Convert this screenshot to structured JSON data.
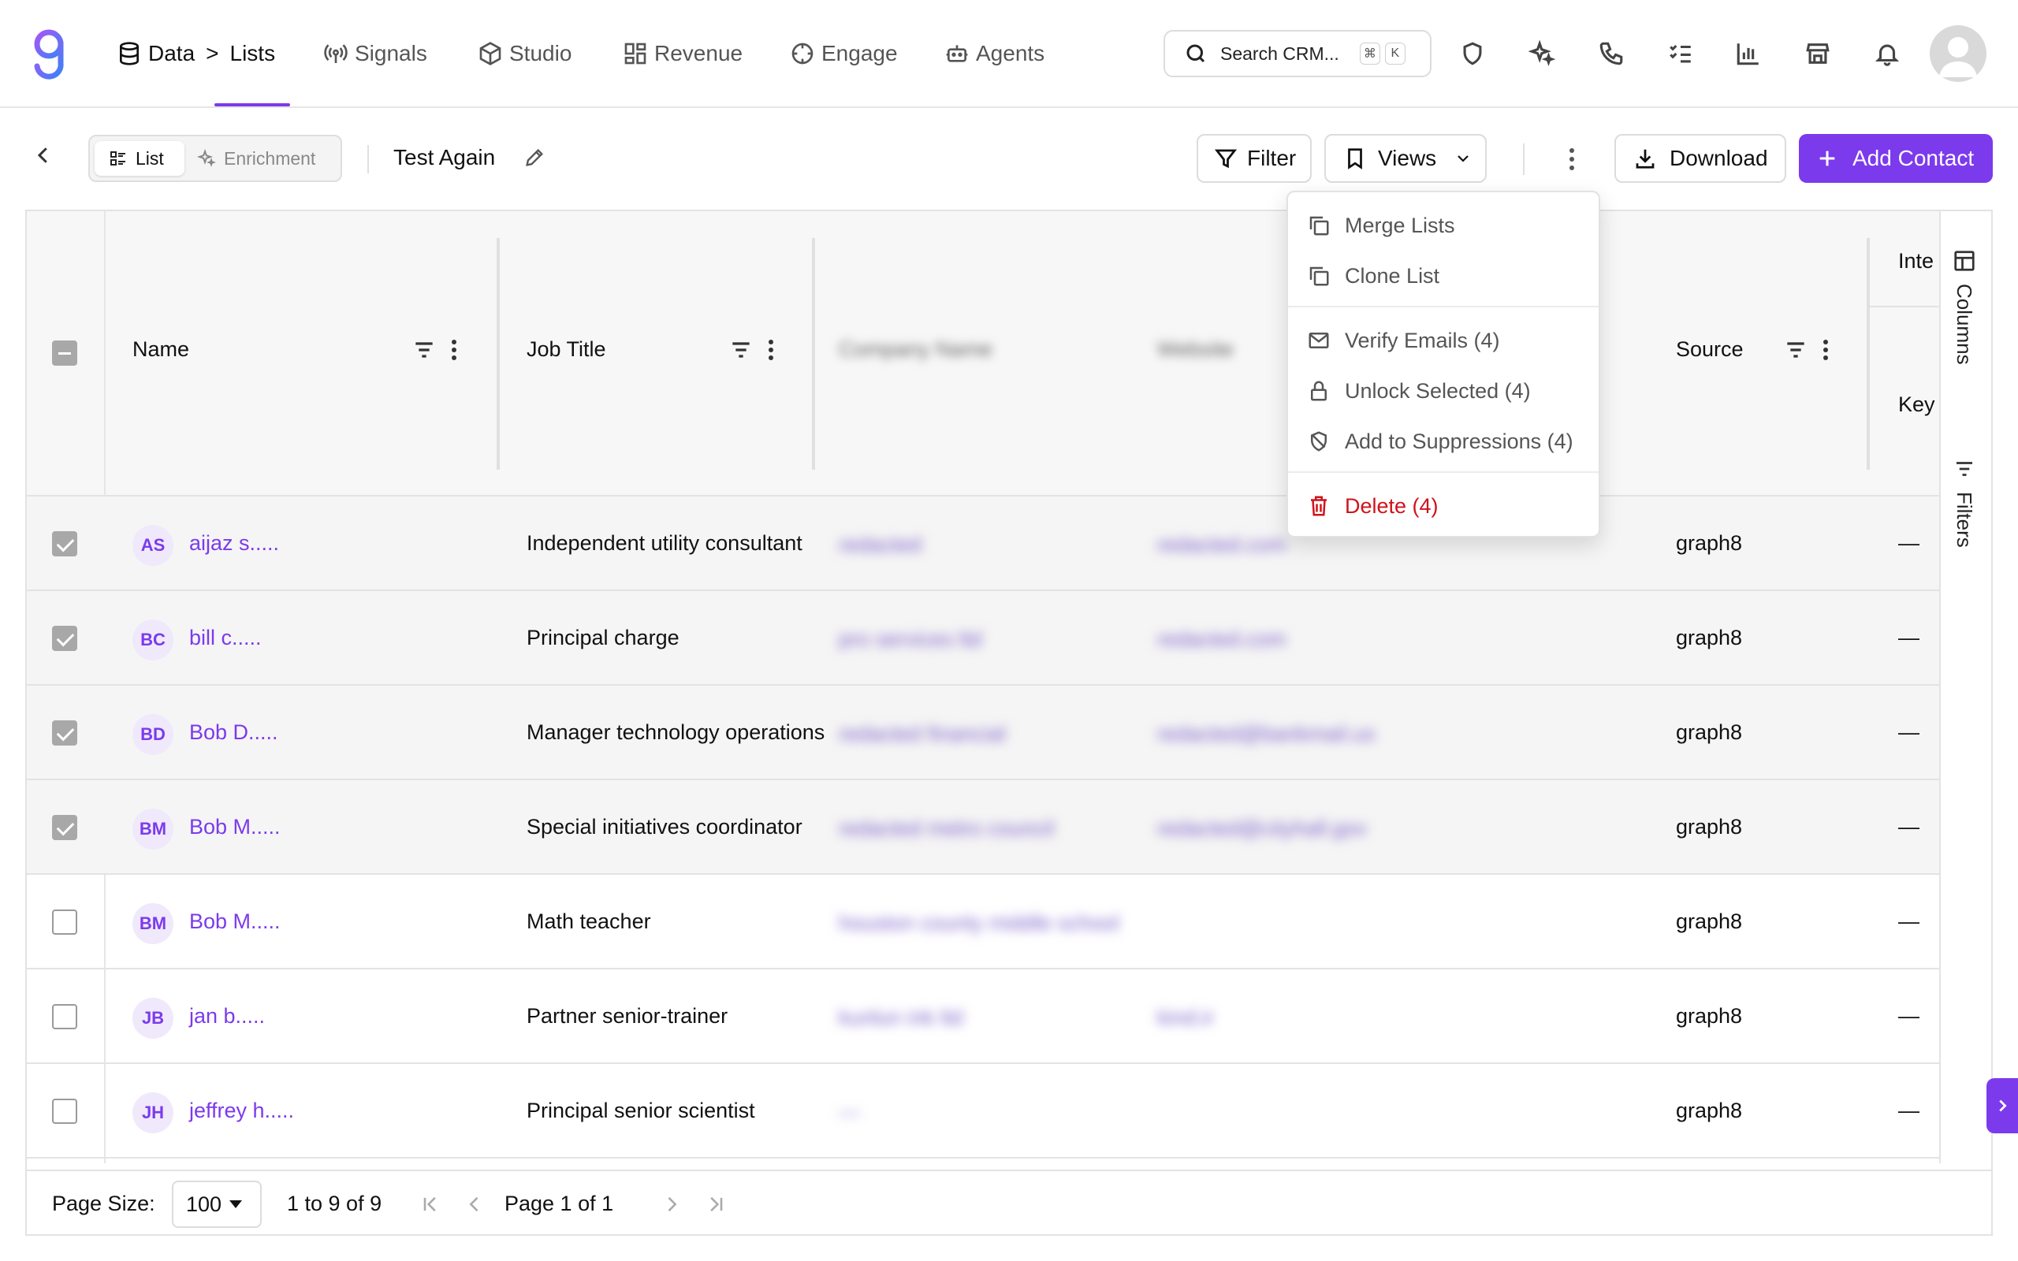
{
  "nav": {
    "breadcrumb_root": "Data",
    "breadcrumb_sep": ">",
    "breadcrumb_current": "Lists",
    "items": [
      "Signals",
      "Studio",
      "Revenue",
      "Engage",
      "Agents"
    ],
    "search_placeholder": "Search CRM...",
    "search_kbd": [
      "⌘",
      "K"
    ],
    "accent_color": "#7c3aed"
  },
  "toolbar": {
    "view_list": "List",
    "view_enrichment": "Enrichment",
    "list_name": "Test Again",
    "filter": "Filter",
    "views": "Views",
    "download": "Download",
    "add_contact": "Add Contact"
  },
  "grid": {
    "columns": {
      "name": "Name",
      "job_title": "Job Title",
      "company": "Company Name",
      "website": "Website",
      "source": "Source",
      "intent_top": "Inte",
      "intent_bottom": "Key"
    },
    "rows": [
      {
        "initials": "AS",
        "name": "aijaz s.....",
        "job_title": "Independent utility consultant",
        "company": "redacted",
        "website": "redacted.com",
        "source": "graph8",
        "intent": "—",
        "selected": true
      },
      {
        "initials": "BC",
        "name": "bill c.....",
        "job_title": "Principal charge",
        "company": "pro services ltd",
        "website": "redacted.com",
        "source": "graph8",
        "intent": "—",
        "selected": true
      },
      {
        "initials": "BD",
        "name": "Bob D.....",
        "job_title": "Manager technology operations",
        "company": "redacted financial",
        "website": "redacted@bankmail.us",
        "source": "graph8",
        "intent": "—",
        "selected": true
      },
      {
        "initials": "BM",
        "name": "Bob M.....",
        "job_title": "Special initiatives coordinator",
        "company": "redacted metro council",
        "website": "redacted@cityhall.gov",
        "source": "graph8",
        "intent": "—",
        "selected": true
      },
      {
        "initials": "BM",
        "name": "Bob M.....",
        "job_title": "Math teacher",
        "company": "houston county middle school",
        "website": "",
        "source": "graph8",
        "intent": "—",
        "selected": false
      },
      {
        "initials": "JB",
        "name": "jan b.....",
        "job_title": "Partner senior-trainer",
        "company": "kunlun ink ltd",
        "website": "kind.ir",
        "source": "graph8",
        "intent": "—",
        "selected": false
      },
      {
        "initials": "JH",
        "name": "jeffrey h.....",
        "job_title": "Principal senior scientist",
        "company": "—",
        "website": "",
        "source": "graph8",
        "intent": "—",
        "selected": false
      }
    ],
    "side_tabs": [
      "Columns",
      "Filters"
    ]
  },
  "footer": {
    "page_size_label": "Page Size:",
    "page_size": "100",
    "range": "1 to 9 of 9",
    "page": "Page 1 of 1"
  },
  "menu": {
    "merge": "Merge Lists",
    "clone": "Clone List",
    "verify": "Verify Emails (4)",
    "unlock": "Unlock Selected (4)",
    "suppress": "Add to Suppressions (4)",
    "delete": "Delete (4)",
    "danger_color": "#d0121b"
  }
}
